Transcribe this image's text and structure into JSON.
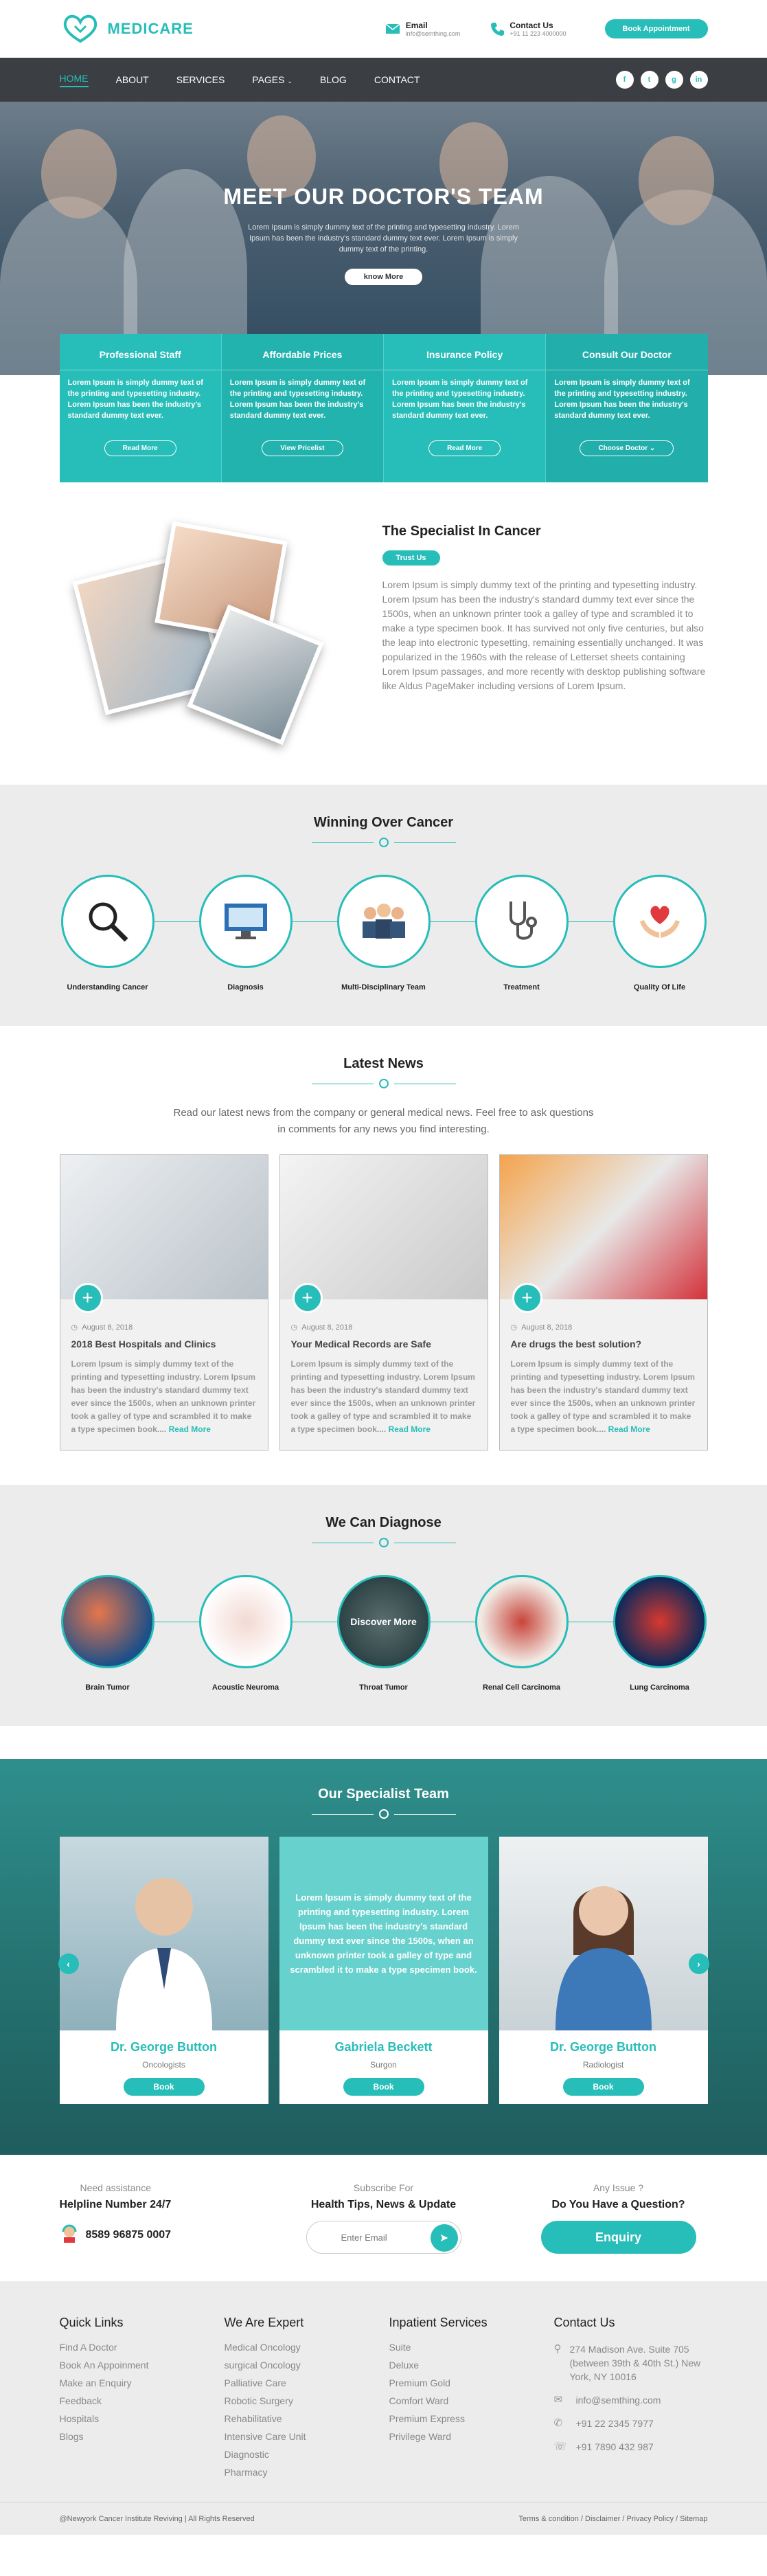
{
  "brand": {
    "name": "MEDICARE"
  },
  "header": {
    "email_label": "Email",
    "email_value": "info@semthing.com",
    "contact_label": "Contact Us",
    "contact_value": "+91 11 223 4000000",
    "book_label": "Book Appointment"
  },
  "nav": {
    "items": [
      "HOME",
      "ABOUT",
      "SERVICES",
      "PAGES",
      "BLOG",
      "CONTACT"
    ],
    "socials": [
      "f",
      "t",
      "g",
      "in"
    ]
  },
  "hero": {
    "title": "MEET OUR DOCTOR'S TEAM",
    "text": "Lorem Ipsum is simply dummy text of the printing and typesetting industry. Lorem Ipsum has been the industry's standard dummy text ever. Lorem Ipsum is simply dummy text of the printing.",
    "button": "know More"
  },
  "features": [
    {
      "title": "Professional Staff",
      "text": "Lorem Ipsum is simply dummy text of the printing and typesetting industry. Lorem Ipsum has been the industry's standard dummy text ever.",
      "button": "Read More"
    },
    {
      "title": "Affordable Prices",
      "text": "Lorem Ipsum is simply dummy text of the printing and typesetting industry. Lorem Ipsum has been the industry's standard dummy text ever.",
      "button": "View Pricelist"
    },
    {
      "title": "Insurance Policy",
      "text": "Lorem Ipsum is simply dummy text of the printing and typesetting industry. Lorem Ipsum has been the industry's standard dummy text ever.",
      "button": "Read More"
    },
    {
      "title": "Consult Our Doctor",
      "text": "Lorem Ipsum is simply dummy text of the printing and typesetting industry. Lorem Ipsum has been the industry's standard dummy text ever.",
      "button": "Choose Doctor"
    }
  ],
  "specialist": {
    "title": "The Specialist In Cancer",
    "badge": "Trust Us",
    "text": "Lorem Ipsum is simply dummy text of the printing and typesetting industry. Lorem Ipsum has been the industry's standard dummy text ever since the 1500s, when an unknown printer took a galley of type and scrambled it to make a type specimen book. It has survived not only five centuries, but also the leap into electronic typesetting, remaining essentially unchanged. It was popularized in the 1960s with the release of Letterset sheets containing Lorem Ipsum passages, and more recently with desktop publishing software like Aldus PageMaker including versions of Lorem Ipsum."
  },
  "winning": {
    "title": "Winning Over Cancer",
    "items": [
      "Understanding Cancer",
      "Diagnosis",
      "Multi-Disciplinary Team",
      "Treatment",
      "Quality Of Life"
    ]
  },
  "news": {
    "title": "Latest News",
    "intro": "Read our latest news from the company or general medical news. Feel free to ask questions in comments for any news you find interesting.",
    "items": [
      {
        "date": "August 8, 2018",
        "title": "2018 Best Hospitals and Clinics",
        "text": "Lorem Ipsum is simply dummy text of the printing and typesetting industry. Lorem Ipsum has been the industry's standard dummy text ever since the 1500s, when an unknown printer took a galley of type and scrambled it to make a type specimen book....",
        "more": "Read More"
      },
      {
        "date": "August 8, 2018",
        "title": "Your Medical Records are Safe",
        "text": "Lorem Ipsum is simply dummy text of the printing and typesetting industry. Lorem Ipsum has been the industry's standard dummy text ever since the 1500s, when an unknown printer took a galley of type and scrambled it to make a type specimen book....",
        "more": "Read More"
      },
      {
        "date": "August 8, 2018",
        "title": "Are drugs the best solution?",
        "text": "Lorem Ipsum is simply dummy text of the printing and typesetting industry. Lorem Ipsum has been the industry's standard dummy text ever since the 1500s, when an unknown printer took a galley of type and scrambled it to make a type specimen book....",
        "more": "Read More"
      }
    ]
  },
  "diagnose": {
    "title": "We Can Diagnose",
    "hover_label": "Discover More",
    "items": [
      "Brain Tumor",
      "Acoustic Neuroma",
      "Throat Tumor",
      "Renal Cell Carcinoma",
      "Lung Carcinoma"
    ]
  },
  "team": {
    "title": "Our Specialist Team",
    "overlay_text": "Lorem Ipsum is simply dummy text of the printing and typesetting industry. Lorem Ipsum has been the industry's standard dummy text ever since the 1500s, when an unknown printer took a galley of type and scrambled it to make a type specimen book.",
    "members": [
      {
        "name": "Dr. George Button",
        "role": "Oncologists",
        "button": "Book"
      },
      {
        "name": "Gabriela Beckett",
        "role": "Surgon",
        "button": "Book"
      },
      {
        "name": "Dr. George Button",
        "role": "Radiologist",
        "button": "Book"
      }
    ]
  },
  "cta": {
    "assist_small": "Need assistance",
    "assist_big": "Helpline Number 24/7",
    "phone": "8589 96875 0007",
    "sub_small": "Subscribe For",
    "sub_big": "Health Tips, News & Update",
    "email_placeholder": "Enter Email",
    "issue_small": "Any Issue ?",
    "issue_big": "Do You Have a Question?",
    "enquiry": "Enquiry"
  },
  "footer": {
    "quick_title": "Quick Links",
    "quick": [
      "Find A Doctor",
      "Book An Appoinment",
      "Make an Enquiry",
      "Feedback",
      "Hospitals",
      "Blogs"
    ],
    "expert_title": "We Are Expert",
    "expert": [
      "Medical Oncology",
      "surgical Oncology",
      "Palliative Care",
      "Robotic Surgery",
      "Rehabilitative",
      "Intensive Care Unit",
      "Diagnostic",
      "Pharmacy"
    ],
    "inpatient_title": "Inpatient Services",
    "inpatient": [
      "Suite",
      "Deluxe",
      "Premium Gold",
      "Comfort Ward",
      "Premium Express",
      "Privilege Ward"
    ],
    "contact_title": "Contact Us",
    "address": "274 Madison Ave. Suite 705 (between 39th & 40th St.) New York, NY 10016",
    "email": "info@semthing.com",
    "phone1": "+91 22 2345 7977",
    "phone2": "+91 7890 432 987",
    "copyright": "@Newyork Cancer Institute Reviving | All Rights Reserved",
    "legal": "Terms & condition / Disclaimer / Privacy Policy / Sitemap"
  },
  "colors": {
    "accent": "#27bdb8",
    "nav_bg": "#3b3f44",
    "section_gray": "#ececec"
  }
}
